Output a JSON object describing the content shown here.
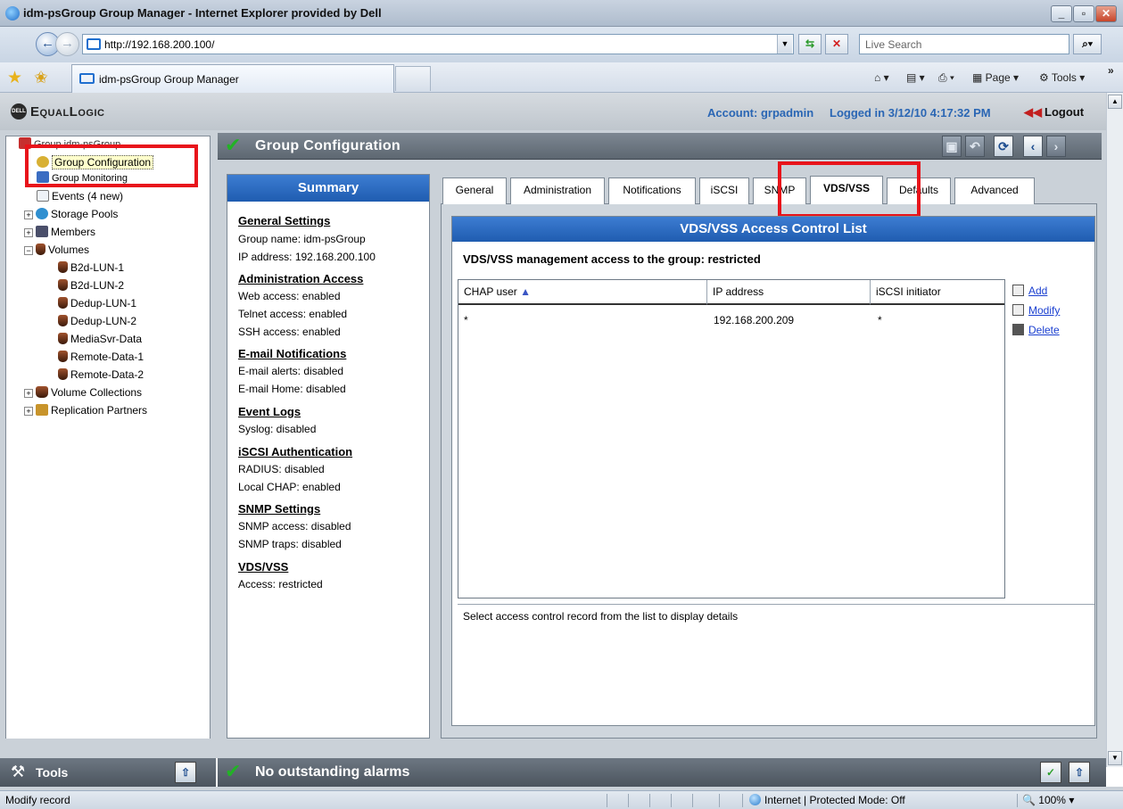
{
  "browser": {
    "title": "idm-psGroup Group Manager - Internet Explorer provided by Dell",
    "url": "http://192.168.200.100/",
    "search_placeholder": "Live Search",
    "tab_title": "idm-psGroup Group Manager",
    "page_menu": "Page",
    "tools_menu": "Tools",
    "status_text": "Modify record",
    "zone_text": "Internet | Protected Mode: Off",
    "zoom": "100%"
  },
  "header": {
    "brand": "EqualLogic",
    "account": "Account: grpadmin",
    "logged_in": "Logged in 3/12/10 4:17:32 PM",
    "logout": "Logout"
  },
  "tree": {
    "root": "Group idm-psGroup",
    "items": [
      {
        "label": "Group Configuration"
      },
      {
        "label": "Group Monitoring"
      },
      {
        "label": "Events (4 new)"
      },
      {
        "label": "Storage Pools"
      },
      {
        "label": "Members"
      },
      {
        "label": "Volumes"
      },
      {
        "label": "B2d-LUN-1"
      },
      {
        "label": "B2d-LUN-2"
      },
      {
        "label": "Dedup-LUN-1"
      },
      {
        "label": "Dedup-LUN-2"
      },
      {
        "label": "MediaSvr-Data"
      },
      {
        "label": "Remote-Data-1"
      },
      {
        "label": "Remote-Data-2"
      },
      {
        "label": "Volume Collections"
      },
      {
        "label": "Replication Partners"
      }
    ]
  },
  "main": {
    "title": "Group Configuration",
    "summary": {
      "title": "Summary",
      "sections": [
        {
          "heading": "General Settings",
          "lines": [
            "Group name: idm-psGroup",
            "IP address:  192.168.200.100"
          ]
        },
        {
          "heading": "Administration Access",
          "lines": [
            "Web access: enabled",
            "Telnet access: enabled",
            "SSH access: enabled"
          ]
        },
        {
          "heading": "E-mail Notifications",
          "lines": [
            "E-mail alerts: disabled",
            "E-mail Home: disabled"
          ]
        },
        {
          "heading": "Event Logs",
          "lines": [
            "Syslog: disabled"
          ]
        },
        {
          "heading": "iSCSI Authentication",
          "lines": [
            "RADIUS: disabled",
            "Local CHAP: enabled"
          ]
        },
        {
          "heading": "SNMP Settings",
          "lines": [
            "SNMP access: disabled",
            "SNMP traps: disabled"
          ]
        },
        {
          "heading": "VDS/VSS",
          "lines": [
            "Access: restricted"
          ]
        }
      ]
    },
    "tabs": [
      "General",
      "Administration",
      "Notifications",
      "iSCSI",
      "SNMP",
      "VDS/VSS",
      "Defaults",
      "Advanced"
    ],
    "acl": {
      "title": "VDS/VSS Access Control List",
      "mgmt_text": "VDS/VSS management access to the group:  restricted",
      "columns": [
        "CHAP user",
        "IP address",
        "iSCSI initiator"
      ],
      "rows": [
        {
          "chap": "*",
          "ip": "192.168.200.209",
          "initiator": "*"
        }
      ],
      "actions": [
        "Add",
        "Modify",
        "Delete"
      ],
      "detail_text": "Select access control record from the list to display details"
    }
  },
  "bottom": {
    "tools": "Tools",
    "alarms": "No outstanding alarms"
  }
}
